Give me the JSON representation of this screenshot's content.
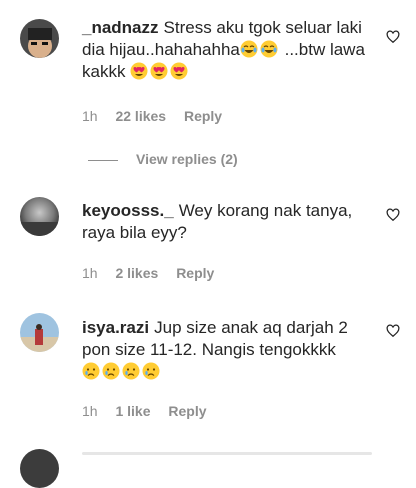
{
  "comments": [
    {
      "username": "_nadnazz",
      "text_before_emoji": "Stress aku tgok seluar laki dia hijau..hahahahha",
      "text_mid": " ...btw lawa kakkk",
      "time": "1h",
      "likes": "22 likes",
      "reply": "Reply",
      "emojis_first": [
        "face-with-tears-of-joy",
        "face-with-tears-of-joy"
      ],
      "emojis_second": [
        "smiling-face-with-heart-eyes",
        "smiling-face-with-heart-eyes",
        "smiling-face-with-heart-eyes"
      ]
    },
    {
      "username": "keyoosss._",
      "text": "Wey korang nak tanya, raya bila eyy?",
      "time": "1h",
      "likes": "2 likes",
      "reply": "Reply"
    },
    {
      "username": "isya.razi",
      "text": "Jup size anak aq darjah 2 pon size 11-12. Nangis tengokkkk",
      "time": "1h",
      "likes": "1 like",
      "reply": "Reply",
      "emojis": [
        "crying-face",
        "crying-face",
        "crying-face",
        "crying-face"
      ]
    }
  ],
  "view_replies": "View replies (2)",
  "colors": {
    "text": "#262626",
    "muted": "#8e8e8e",
    "emoji_yellow": "#FFCC33"
  }
}
